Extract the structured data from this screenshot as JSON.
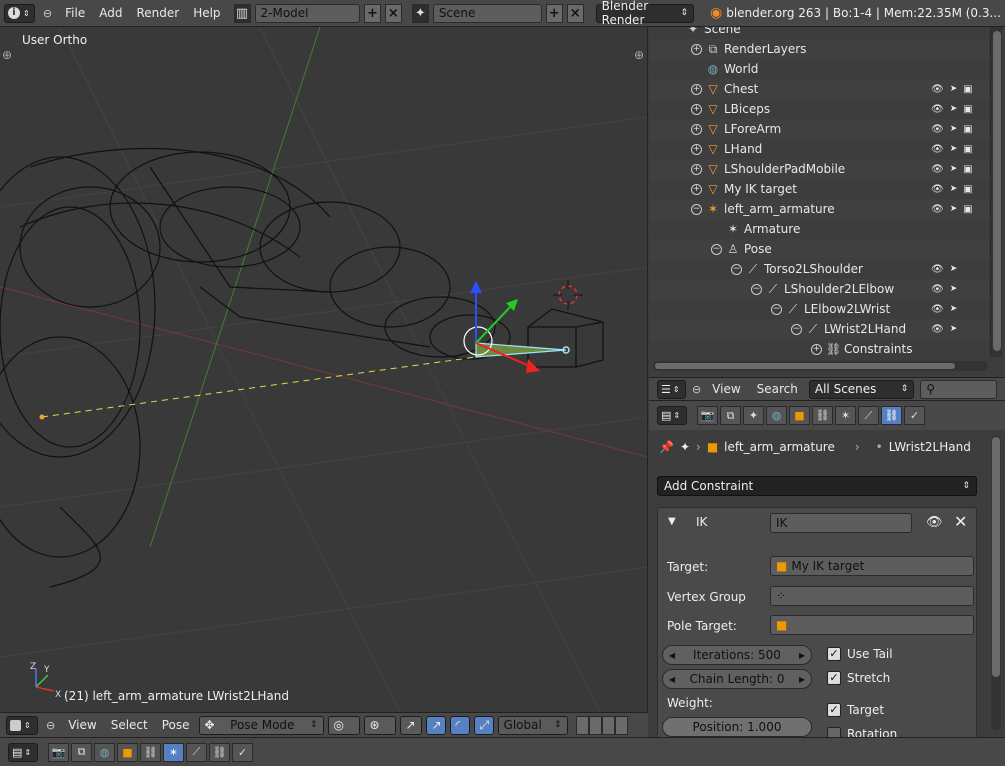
{
  "topbar": {
    "menus": [
      "File",
      "Add",
      "Render",
      "Help"
    ],
    "screen_layout": "2-Model",
    "scene": "Scene",
    "render_engine": "Blender Render",
    "stats": "blender.org 263 | Bo:1-4 | Mem:22.35M (0.3..."
  },
  "viewport": {
    "view_label": "User Ortho",
    "status": "(21) left_arm_armature LWrist2LHand",
    "axis_labels": [
      "Z",
      "Y",
      "X"
    ]
  },
  "viewport_header": {
    "menus": [
      "View",
      "Select",
      "Pose"
    ],
    "mode": "Pose Mode",
    "orientation": "Global"
  },
  "outliner": {
    "rows": [
      {
        "label": "Scene",
        "depth": 0,
        "icon": "scene-icon"
      },
      {
        "label": "RenderLayers",
        "depth": 1,
        "icon": "renderlayers-icon",
        "expand": "+"
      },
      {
        "label": "World",
        "depth": 1,
        "icon": "world-icon"
      },
      {
        "label": "Chest",
        "depth": 1,
        "icon": "mesh-object-icon",
        "expand": "+",
        "vis": true
      },
      {
        "label": "LBiceps",
        "depth": 1,
        "icon": "mesh-object-icon",
        "expand": "+",
        "vis": true
      },
      {
        "label": "LForeArm",
        "depth": 1,
        "icon": "mesh-object-icon",
        "expand": "+",
        "vis": true
      },
      {
        "label": "LHand",
        "depth": 1,
        "icon": "mesh-object-icon",
        "expand": "+",
        "vis": true
      },
      {
        "label": "LShoulderPadMobile",
        "depth": 1,
        "icon": "mesh-object-icon",
        "expand": "+",
        "vis": true
      },
      {
        "label": "My IK target",
        "depth": 1,
        "icon": "mesh-object-icon",
        "expand": "+",
        "vis": true
      },
      {
        "label": "left_arm_armature",
        "depth": 1,
        "icon": "armature-object-icon",
        "expand": "−",
        "vis": true
      },
      {
        "label": "Armature",
        "depth": 2,
        "icon": "armature-data-icon"
      },
      {
        "label": "Pose",
        "depth": 2,
        "icon": "pose-icon",
        "expand": "−"
      },
      {
        "label": "Torso2LShoulder",
        "depth": 3,
        "icon": "bone-icon",
        "expand": "−",
        "vis": "bone"
      },
      {
        "label": "LShoulder2LElbow",
        "depth": 4,
        "icon": "bone-icon",
        "expand": "−",
        "vis": "bone"
      },
      {
        "label": "LElbow2LWrist",
        "depth": 5,
        "icon": "bone-icon",
        "expand": "−",
        "vis": "bone"
      },
      {
        "label": "LWrist2LHand",
        "depth": 6,
        "icon": "bone-icon",
        "expand": "−",
        "vis": "bone"
      },
      {
        "label": "Constraints",
        "depth": 7,
        "icon": "constraint-icon",
        "expand": "+"
      }
    ]
  },
  "outliner_header": {
    "menus": [
      "View",
      "Search"
    ],
    "display_mode": "All Scenes"
  },
  "properties": {
    "breadcrumb": [
      "left_arm_armature",
      "LWrist2LHand"
    ],
    "add_constraint": "Add Constraint",
    "constraint": {
      "type_label": "IK",
      "name": "IK",
      "target_label": "Target:",
      "target_value": "My IK target",
      "vertex_group_label": "Vertex Group",
      "pole_target_label": "Pole Target:",
      "iterations": "Iterations: 500",
      "chain_length": "Chain Length: 0",
      "use_tail": "Use Tail",
      "stretch": "Stretch",
      "weight_label": "Weight:",
      "position": "Position: 1.000",
      "target_check": "Target",
      "rotation_check": "Rotation"
    }
  }
}
